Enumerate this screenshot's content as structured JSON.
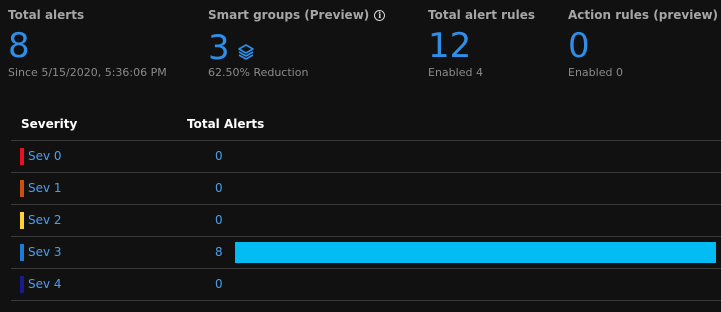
{
  "summary": {
    "total_alerts": {
      "title": "Total alerts",
      "value": "8",
      "sub": "Since 5/15/2020, 5:36:06 PM"
    },
    "smart_groups": {
      "title": "Smart groups (Preview)",
      "value": "3",
      "sub": "62.50% Reduction",
      "icon": "layers-icon"
    },
    "total_alert_rules": {
      "title": "Total alert rules",
      "value": "12",
      "sub": "Enabled 4"
    },
    "action_rules": {
      "title": "Action rules (preview)",
      "value": "0",
      "sub": "Enabled 0"
    }
  },
  "table": {
    "headers": {
      "severity": "Severity",
      "total_alerts": "Total Alerts"
    },
    "max": 8,
    "rows": [
      {
        "label": "Sev 0",
        "count": "0",
        "value": 0,
        "color": "#e81123"
      },
      {
        "label": "Sev 1",
        "count": "0",
        "value": 0,
        "color": "#ca5010"
      },
      {
        "label": "Sev 2",
        "count": "0",
        "value": 0,
        "color": "#ffd335"
      },
      {
        "label": "Sev 3",
        "count": "8",
        "value": 8,
        "color": "#1e7bd3"
      },
      {
        "label": "Sev 4",
        "count": "0",
        "value": 0,
        "color": "#1a1a8c"
      }
    ]
  },
  "colors": {
    "accent": "#2f8ee8",
    "bar": "#00bcf2"
  }
}
